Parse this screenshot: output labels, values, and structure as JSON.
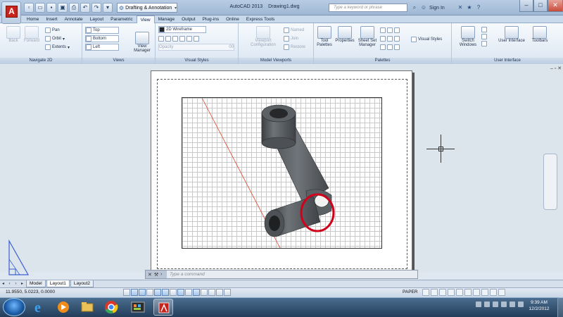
{
  "titlebar": {
    "workspace": "Drafting & Annotation",
    "app_title": "AutoCAD 2013",
    "file_name": "Drawing1.dwg",
    "search_placeholder": "Type a keyword or phrase",
    "sign_in": "Sign In"
  },
  "ribbon_tabs": [
    "Home",
    "Insert",
    "Annotate",
    "Layout",
    "Parametric",
    "View",
    "Manage",
    "Output",
    "Plug-ins",
    "Online",
    "Express Tools"
  ],
  "active_tab": "View",
  "ribbon": {
    "navigate": {
      "title": "Navigate 2D",
      "back": "Back",
      "forward": "Forward",
      "pan": "Pan",
      "orbit": "Orbit",
      "extents": "Extents"
    },
    "views": {
      "title": "Views",
      "top": "Top",
      "bottom": "Bottom",
      "left": "Left",
      "view_manager": "View Manager"
    },
    "visual_styles": {
      "title": "Visual Styles",
      "style": "2D Wireframe",
      "opacity": "Opacity",
      "opacity_value": "00"
    },
    "model_viewports": {
      "title": "Model Viewports",
      "configuration": "Viewport Configuration",
      "named": "Named",
      "join": "Join",
      "restore": "Restore"
    },
    "palettes": {
      "title": "Palettes",
      "tool_palettes": "Tool Palettes",
      "properties": "Properties",
      "sheet_set": "Sheet Set Manager",
      "visual_styles": "Visual Styles"
    },
    "user_interface": {
      "title": "User Interface",
      "switch_windows": "Switch Windows",
      "user_interface": "User Interface",
      "toolbars": "Toolbars"
    }
  },
  "command": {
    "placeholder": "Type a command"
  },
  "layout_tabs": [
    "Model",
    "Layout1",
    "Layout2"
  ],
  "active_layout": "Layout1",
  "status": {
    "coordinates": "11.9550, 5.0223, 0.0000",
    "paper": "PAPER"
  },
  "clock": {
    "time": "9:39 AM",
    "date": "12/2/2012"
  },
  "colors": {
    "highlight_circle": "#d0021b",
    "autocad_red": "#c8231b",
    "ribbon_bg": "#dbe6f2",
    "taskbar": "#223d5a"
  }
}
